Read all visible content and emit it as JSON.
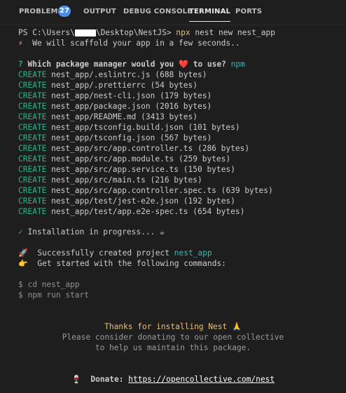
{
  "tabs": {
    "problems": "PROBLEMS",
    "problems_count": "27",
    "output": "OUTPUT",
    "debug_console": "DEBUG CONSOLE",
    "terminal": "TERMINAL",
    "ports": "PORTS"
  },
  "terminal": {
    "prompt_start": "PS C:\\Users\\",
    "prompt_end": "\\Desktop\\NestJS>",
    "command_npx": "npx",
    "command_rest": " nest new nest_app",
    "scaffold_icon": "⚡",
    "scaffold_text": "  We will scaffold your app in a few seconds..",
    "question_mark": "?",
    "question_text": " Which package manager would you ",
    "heart": "❤️",
    "question_tail": " to use?",
    "question_answer": " npm",
    "create_word": "CREATE",
    "files": [
      "nest_app/.eslintrc.js (688 bytes)",
      "nest_app/.prettierrc (54 bytes)",
      "nest_app/nest-cli.json (179 bytes)",
      "nest_app/package.json (2016 bytes)",
      "nest_app/README.md (3413 bytes)",
      "nest_app/tsconfig.build.json (101 bytes)",
      "nest_app/tsconfig.json (567 bytes)",
      "nest_app/src/app.controller.ts (286 bytes)",
      "nest_app/src/app.module.ts (259 bytes)",
      "nest_app/src/app.service.ts (150 bytes)",
      "nest_app/src/main.ts (216 bytes)",
      "nest_app/src/app.controller.spec.ts (639 bytes)",
      "nest_app/test/jest-e2e.json (192 bytes)",
      "nest_app/test/app.e2e-spec.ts (654 bytes)"
    ],
    "install_check": "✓",
    "install_text": " Installation in progress... ",
    "install_emoji": "☕",
    "rocket": "🚀",
    "success_text": "  Successfully created project ",
    "project_name": "nest_app",
    "point": "👉",
    "get_started": "  Get started with the following commands:",
    "cmd1": "$ cd nest_app",
    "cmd2": "$ npm run start",
    "thanks": "Thanks for installing Nest ",
    "thanks_emoji": "🙏",
    "consider": "Please consider donating to our open collective",
    "maintain": "to help us maintain this package.",
    "wine": "🍷",
    "donate_label": "  Donate: ",
    "donate_url": "https://opencollective.com/nest"
  }
}
